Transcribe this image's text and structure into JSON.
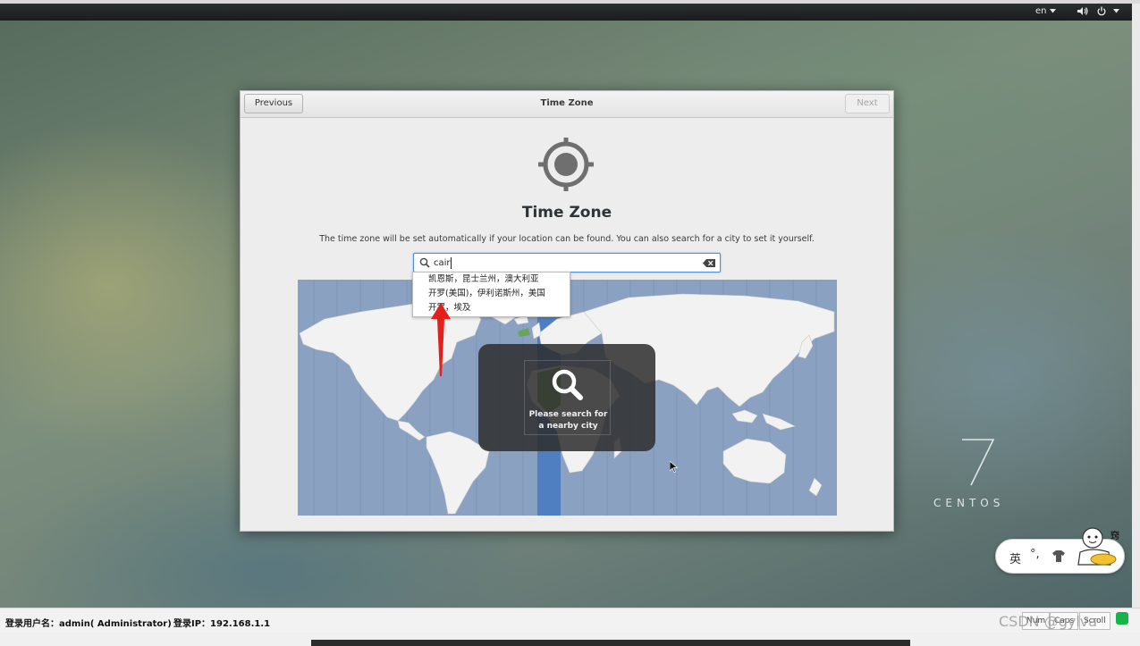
{
  "topbar": {
    "language": "en",
    "volume_icon": "volume-icon",
    "power_icon": "power-icon"
  },
  "dialog": {
    "previous_label": "Previous",
    "title": "Time Zone",
    "next_label": "Next",
    "heading": "Time Zone",
    "description": "The time zone will be set automatically if your location can be found. You can also search for a city to set it yourself."
  },
  "search": {
    "value": "cair",
    "icon": "search-icon",
    "clear_icon": "clear-text-icon"
  },
  "suggestions": [
    "凯恩斯，昆士兰州，澳大利亚",
    "开罗(美国)，伊利诺斯州，美国",
    "开罗，埃及"
  ],
  "map_overlay": {
    "line1": "Please search for",
    "line2": "a nearby city"
  },
  "branding": {
    "number": "7",
    "word": "CENTOS"
  },
  "ime": {
    "language": "英",
    "punctuation": "°,",
    "badge": "窍"
  },
  "statusbar": {
    "user": "登录用户名：admin( Administrator)",
    "ip": "登录IP：192.168.1.1",
    "num": "Num",
    "caps": "Caps",
    "scroll": "Scroll"
  },
  "watermark": "CSDN @gylva",
  "colors": {
    "accent": "#4a90d9",
    "map_ocean": "#8ba1c1",
    "map_land": "#f2f2f2",
    "timezone_highlight": "#4f7fc0",
    "arrow": "#e3211c"
  }
}
